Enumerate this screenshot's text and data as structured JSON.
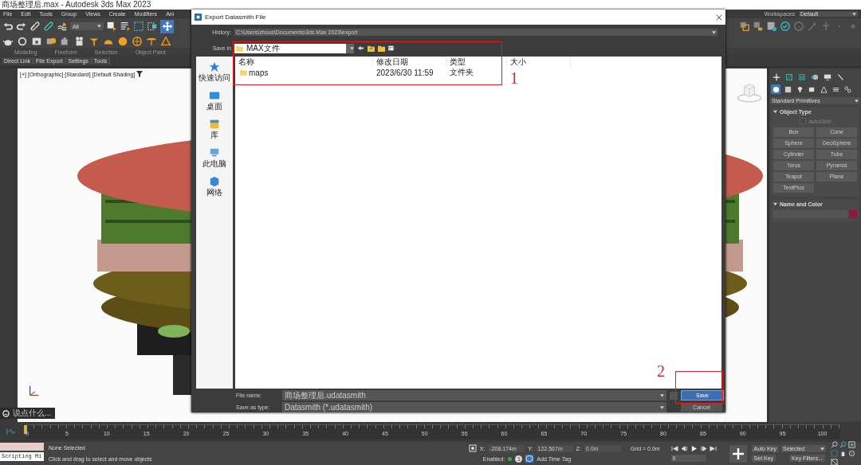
{
  "title_bar": {
    "title": "商场整理后.max - Autodesk 3ds Max 2023"
  },
  "menu": [
    "File",
    "Edit",
    "Tools",
    "Group",
    "Views",
    "Create",
    "Modifiers",
    "Ani"
  ],
  "workspaces": {
    "label": "Workspaces:",
    "value": "Default"
  },
  "selection_filter": "All",
  "move_tool": {
    "selected": true
  },
  "ribbon_tabs": [
    "Modeling",
    "Freeform",
    "Selection",
    "Object Paint"
  ],
  "plugin_tabs": [
    "Direct Link",
    "File Export",
    "Settings",
    "Tools"
  ],
  "viewport": {
    "labels": [
      "[+]",
      "[Orthographic]",
      "[Standard]",
      "[Default Shading]"
    ]
  },
  "command_panel": {
    "categories": [
      {
        "selected": true
      },
      {
        "selected": false
      },
      {
        "selected": false
      },
      {
        "selected": false
      },
      {
        "selected": false
      },
      {
        "selected": false
      },
      {
        "selected": false
      }
    ],
    "dropdown": "Standard Primitives",
    "object_type": {
      "title": "Object Type",
      "expanded": true,
      "autogrid": {
        "label": "AutoGrid",
        "checked": false,
        "disabled": true
      },
      "buttons": [
        "Box",
        "Cone",
        "Sphere",
        "GeoSphere",
        "Cylinder",
        "Tube",
        "Torus",
        "Pyramid",
        "Teapot",
        "Plane",
        "TextPlus"
      ]
    },
    "name_and_color": {
      "title": "Name and Color",
      "expanded": true,
      "color": "#8b1a35"
    }
  },
  "chat": {
    "placeholder": "说点什么..."
  },
  "dialog": {
    "title": "Export Datasmith File",
    "history_label": "History:",
    "history": "C:\\Users\\zhous\\Documents\\3ds Max 2023\\export",
    "save_in_label": "Save in",
    "folder": "MAX文件",
    "places": [
      "快速访问",
      "桌面",
      "库",
      "此电脑",
      "网络"
    ],
    "columns": [
      "名称",
      "修改日期",
      "类型",
      "大小"
    ],
    "rows": [
      {
        "name": "maps",
        "date": "2023/6/30 11:59",
        "type": "文件夹"
      }
    ],
    "file_name_label": "File name:",
    "file_name": "商场整理后.udatasmith",
    "type_label": "Save as type:",
    "type": "Datasmith (*.udatasmith)",
    "save": "Save",
    "cancel": "Cancel"
  },
  "annotations": [
    "1",
    "2"
  ],
  "timeline": {
    "level": 0,
    "ticks": [
      "0",
      "5",
      "10",
      "15",
      "20",
      "25",
      "30",
      "35",
      "40",
      "45",
      "50",
      "55",
      "60",
      "65",
      "70",
      "75",
      "80",
      "85",
      "90",
      "95",
      "100"
    ]
  },
  "status": {
    "script_label": "Scripting Mi",
    "selection": "None Selected",
    "prompt": "Click and drag to select and move objects",
    "x_label": "X:",
    "x": "-208.174m",
    "y_label": "Y:",
    "y": "122.567m",
    "z_label": "Z:",
    "z": "0.0m",
    "grid": "Grid = 0.0m",
    "enabled_label": "Enabled:",
    "enabled": true,
    "tag_count": "1",
    "time_tag": "Add Time Tag",
    "frame": "0",
    "auto_key": "Auto Key",
    "set_key": "Set Key",
    "key_mode": "Selected",
    "key_filters": "Key Filters..."
  }
}
